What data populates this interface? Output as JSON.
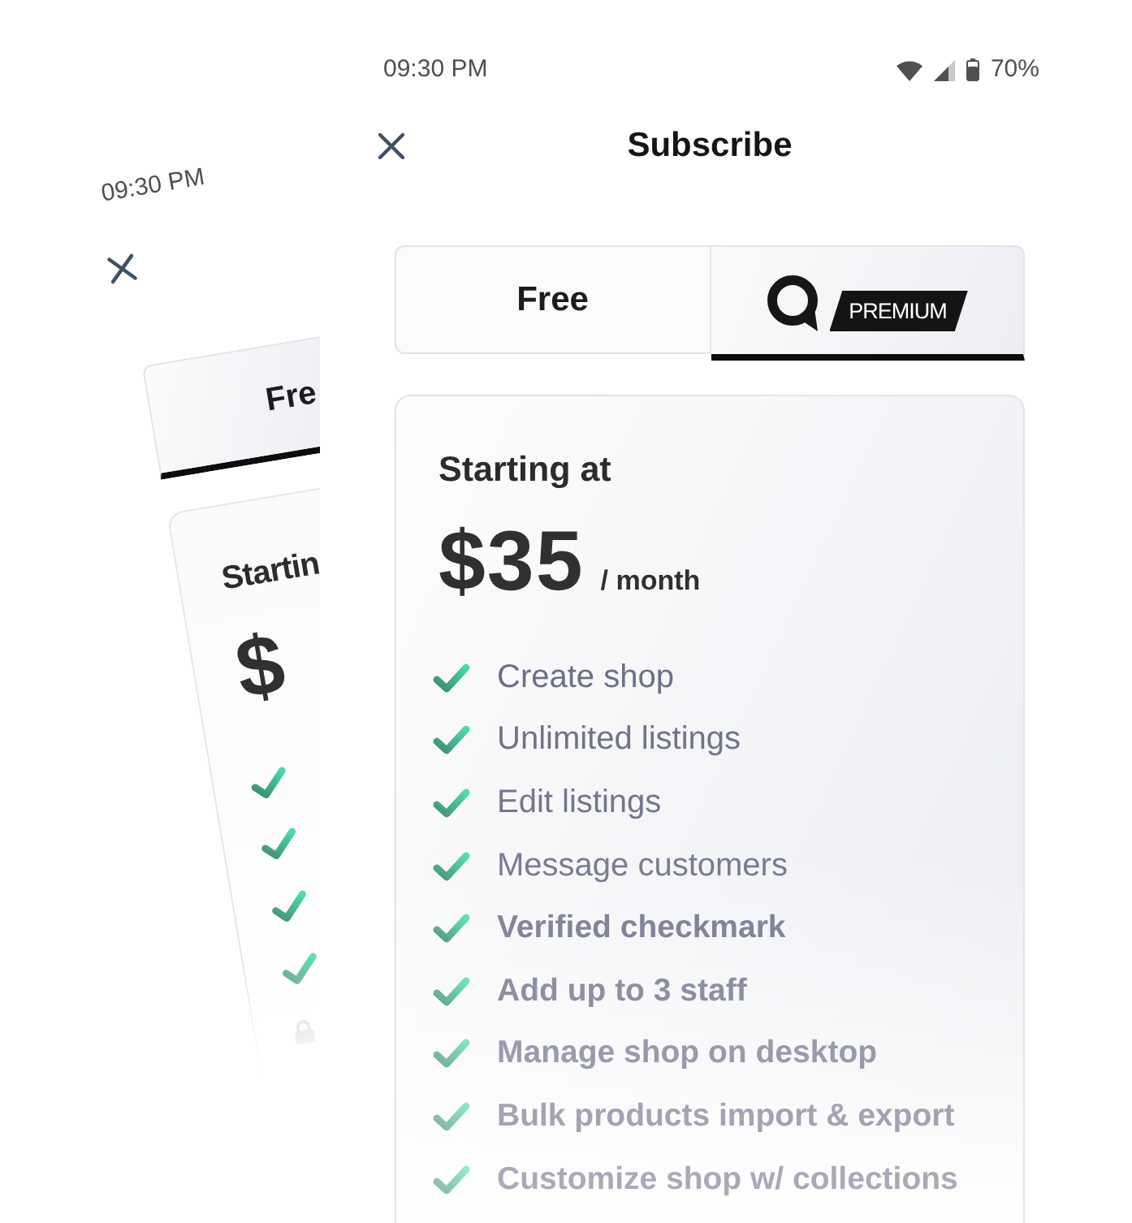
{
  "back_screen": {
    "status_bar": {
      "time": "09:30 PM"
    },
    "tabs": [
      {
        "label": "Fre",
        "selected": true
      }
    ],
    "plan": {
      "heading": "Startin",
      "price": "$",
      "features": [
        {
          "kind": "included"
        },
        {
          "kind": "included"
        },
        {
          "kind": "included"
        },
        {
          "kind": "included"
        },
        {
          "kind": "locked"
        }
      ]
    }
  },
  "screen": {
    "status_bar": {
      "time": "09:30 PM",
      "battery": "70%"
    },
    "title": "Subscribe",
    "tabs": [
      {
        "kind": "text",
        "label": "Free",
        "selected": false
      },
      {
        "kind": "logo",
        "badge": "PREMIUM",
        "selected": true
      }
    ],
    "plan": {
      "heading": "Starting at",
      "price": "$35",
      "period": "/ month",
      "features": [
        {
          "kind": "standard",
          "label": "Create shop"
        },
        {
          "kind": "standard",
          "label": "Unlimited listings"
        },
        {
          "kind": "standard",
          "label": "Edit listings"
        },
        {
          "kind": "standard",
          "label": "Message customers"
        },
        {
          "kind": "featured",
          "label": "Verified checkmark"
        },
        {
          "kind": "featured",
          "label": "Add up to 3 staff"
        },
        {
          "kind": "featured",
          "label": "Manage shop on desktop"
        },
        {
          "kind": "featured",
          "label": "Bulk products import & export"
        },
        {
          "kind": "featured",
          "label": "Customize shop w/ collections"
        }
      ]
    }
  }
}
